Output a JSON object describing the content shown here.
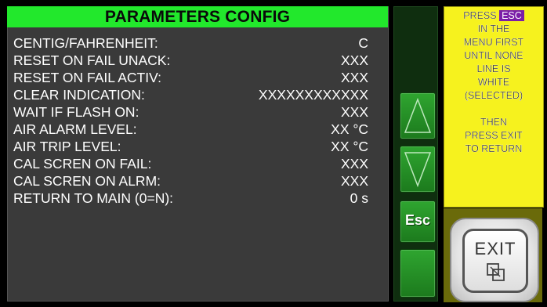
{
  "header": {
    "title": "PARAMETERS CONFIG"
  },
  "parameters": [
    {
      "label": "CENTIG/FAHRENHEIT:",
      "value": "C"
    },
    {
      "label": "RESET ON FAIL UNACK:",
      "value": "XXX"
    },
    {
      "label": "RESET ON FAIL ACTIV:",
      "value": "XXX"
    },
    {
      "label": "CLEAR INDICATION:",
      "value": "XXXXXXXXXXXX"
    },
    {
      "label": "WAIT IF FLASH ON:",
      "value": "XXX"
    },
    {
      "label": "AIR ALARM LEVEL:",
      "value": "XX °C"
    },
    {
      "label": "AIR TRIP LEVEL:",
      "value": "XX °C"
    },
    {
      "label": "CAL SCREN ON FAIL:",
      "value": "XXX"
    },
    {
      "label": "CAL SCREN ON ALRM:",
      "value": "XXX"
    },
    {
      "label": "RETURN TO MAIN (0=N):",
      "value": "0 s"
    }
  ],
  "nav": {
    "up_icon": "triangle-up-icon",
    "down_icon": "triangle-down-icon",
    "esc_label": "Esc"
  },
  "help": {
    "press": "PRESS",
    "esc_badge": "ESC",
    "lines": [
      "IN THE",
      "MENU FIRST",
      "UNTIL NONE",
      "LINE IS",
      "WHITE",
      "(SELECTED)",
      "",
      "THEN",
      "PRESS EXIT",
      "TO RETURN"
    ]
  },
  "exit": {
    "label": "EXIT",
    "icon": "exit-squares-icon"
  },
  "colors": {
    "title_green": "#22e82c",
    "panel_gray": "#3a3a3a",
    "nav_green": "#2fa530",
    "help_yellow": "#f6f21e",
    "esc_purple": "#7b1ea8"
  }
}
